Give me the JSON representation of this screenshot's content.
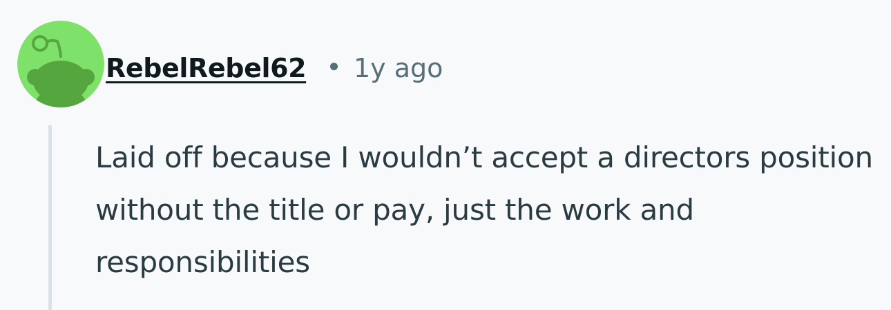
{
  "comment": {
    "author": "RebelRebel62",
    "separator": "•",
    "age": "1y ago",
    "body": "Laid off because I wouldn’t accept a directors position without the title or pay, just the work and responsibilities"
  },
  "avatar": {
    "icon": "snoo-avatar-icon",
    "background_color": "#7ee26a",
    "figure_color": "#55a63f"
  },
  "colors": {
    "background": "#f8f9fa",
    "username": "#0f1a1c",
    "meta": "#576f76",
    "body_text": "#2a3c42",
    "thread_line": "#d9e2e6"
  }
}
